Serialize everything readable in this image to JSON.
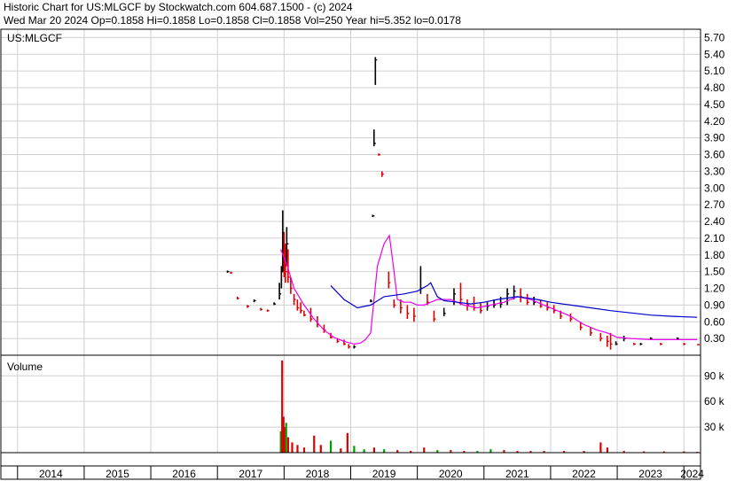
{
  "header": {
    "line1": "Historic Chart for US:MLGCF by Stockwatch.com 604.687.1500 - (c) 2024",
    "line2": "Wed Mar 20 2024   Op=0.1858   Hi=0.1858   Lo=0.1858   Cl=0.1858   Vol=250   Year hi=5.352   lo=0.0178"
  },
  "colors": {
    "background": "#ffffff",
    "grid": "#d0d0d0",
    "price_up": "#000000",
    "price_down": "#dd0000",
    "ma_short": "#ee00ee",
    "ma_long": "#0000cc",
    "volume_up": "#00a000",
    "volume_down": "#dd0000"
  },
  "chart_data": [
    {
      "type": "line",
      "label": "US:MLGCF",
      "grid": true,
      "ylim": [
        0,
        5.85
      ],
      "yticks": [
        "5.70",
        "5.40",
        "5.10",
        "4.80",
        "4.50",
        "4.20",
        "3.90",
        "3.60",
        "3.30",
        "3.00",
        "2.70",
        "2.40",
        "2.10",
        "1.80",
        "1.50",
        "1.20",
        "0.90",
        "0.60",
        "0.30"
      ],
      "yticks_values": [
        5.7,
        5.4,
        5.1,
        4.8,
        4.5,
        4.2,
        3.9,
        3.6,
        3.3,
        3.0,
        2.7,
        2.4,
        2.1,
        1.8,
        1.5,
        1.2,
        0.9,
        0.6,
        0.3
      ],
      "xlim": [
        2013.75,
        2024.25
      ],
      "xticks": [
        "2014",
        "2015",
        "2016",
        "2017",
        "2018",
        "2019",
        "2020",
        "2021",
        "2022",
        "2023",
        "2024"
      ],
      "price_bars": [
        {
          "t": 2017.15,
          "hi": 1.52,
          "lo": 1.48,
          "cl": 1.5
        },
        {
          "t": 2017.2,
          "hi": 1.5,
          "lo": 1.46,
          "cl": 1.48
        },
        {
          "t": 2017.3,
          "hi": 1.05,
          "lo": 1.0,
          "cl": 1.02
        },
        {
          "t": 2017.45,
          "hi": 0.9,
          "lo": 0.85,
          "cl": 0.88
        },
        {
          "t": 2017.55,
          "hi": 1.0,
          "lo": 0.95,
          "cl": 0.98
        },
        {
          "t": 2017.65,
          "hi": 0.85,
          "lo": 0.8,
          "cl": 0.82
        },
        {
          "t": 2017.75,
          "hi": 0.82,
          "lo": 0.78,
          "cl": 0.8
        },
        {
          "t": 2017.85,
          "hi": 0.95,
          "lo": 0.9,
          "cl": 0.92
        },
        {
          "t": 2017.93,
          "hi": 1.3,
          "lo": 1.0,
          "cl": 1.1
        },
        {
          "t": 2017.96,
          "hi": 1.6,
          "lo": 1.2,
          "cl": 1.5
        },
        {
          "t": 2017.98,
          "hi": 2.6,
          "lo": 1.5,
          "cl": 2.2
        },
        {
          "t": 2018.0,
          "hi": 2.2,
          "lo": 1.4,
          "cl": 1.6
        },
        {
          "t": 2018.02,
          "hi": 2.0,
          "lo": 1.3,
          "cl": 1.5
        },
        {
          "t": 2018.04,
          "hi": 2.3,
          "lo": 1.6,
          "cl": 2.0
        },
        {
          "t": 2018.06,
          "hi": 1.9,
          "lo": 1.3,
          "cl": 1.4
        },
        {
          "t": 2018.1,
          "hi": 1.4,
          "lo": 1.1,
          "cl": 1.2
        },
        {
          "t": 2018.15,
          "hi": 1.1,
          "lo": 0.9,
          "cl": 1.0
        },
        {
          "t": 2018.2,
          "hi": 1.0,
          "lo": 0.8,
          "cl": 0.85
        },
        {
          "t": 2018.25,
          "hi": 0.95,
          "lo": 0.75,
          "cl": 0.8
        },
        {
          "t": 2018.3,
          "hi": 0.8,
          "lo": 0.7,
          "cl": 0.72
        },
        {
          "t": 2018.4,
          "hi": 0.85,
          "lo": 0.6,
          "cl": 0.65
        },
        {
          "t": 2018.5,
          "hi": 0.7,
          "lo": 0.5,
          "cl": 0.55
        },
        {
          "t": 2018.6,
          "hi": 0.55,
          "lo": 0.4,
          "cl": 0.45
        },
        {
          "t": 2018.7,
          "hi": 0.4,
          "lo": 0.3,
          "cl": 0.32
        },
        {
          "t": 2018.8,
          "hi": 0.3,
          "lo": 0.22,
          "cl": 0.25
        },
        {
          "t": 2018.9,
          "hi": 0.28,
          "lo": 0.18,
          "cl": 0.2
        },
        {
          "t": 2018.97,
          "hi": 0.2,
          "lo": 0.12,
          "cl": 0.15
        },
        {
          "t": 2019.05,
          "hi": 0.18,
          "lo": 0.12,
          "cl": 0.15
        },
        {
          "t": 2019.3,
          "hi": 1.0,
          "lo": 0.95,
          "cl": 0.97
        },
        {
          "t": 2019.33,
          "hi": 2.52,
          "lo": 2.48,
          "cl": 2.5
        },
        {
          "t": 2019.35,
          "hi": 4.05,
          "lo": 3.75,
          "cl": 3.8
        },
        {
          "t": 2019.37,
          "hi": 5.35,
          "lo": 4.85,
          "cl": 5.3
        },
        {
          "t": 2019.42,
          "hi": 3.62,
          "lo": 3.58,
          "cl": 3.6
        },
        {
          "t": 2019.47,
          "hi": 3.3,
          "lo": 3.2,
          "cl": 3.25
        },
        {
          "t": 2019.57,
          "hi": 1.5,
          "lo": 1.2,
          "cl": 1.3
        },
        {
          "t": 2019.65,
          "hi": 1.0,
          "lo": 0.85,
          "cl": 0.9
        },
        {
          "t": 2019.75,
          "hi": 1.0,
          "lo": 0.75,
          "cl": 0.85
        },
        {
          "t": 2019.85,
          "hi": 0.9,
          "lo": 0.65,
          "cl": 0.75
        },
        {
          "t": 2019.95,
          "hi": 0.85,
          "lo": 0.6,
          "cl": 0.7
        },
        {
          "t": 2020.05,
          "hi": 1.6,
          "lo": 1.1,
          "cl": 1.2
        },
        {
          "t": 2020.15,
          "hi": 1.1,
          "lo": 0.9,
          "cl": 0.95
        },
        {
          "t": 2020.25,
          "hi": 0.8,
          "lo": 0.6,
          "cl": 0.65
        },
        {
          "t": 2020.4,
          "hi": 0.85,
          "lo": 0.7,
          "cl": 0.75
        },
        {
          "t": 2020.55,
          "hi": 1.2,
          "lo": 0.9,
          "cl": 1.1
        },
        {
          "t": 2020.65,
          "hi": 1.3,
          "lo": 0.9,
          "cl": 1.0
        },
        {
          "t": 2020.75,
          "hi": 1.0,
          "lo": 0.8,
          "cl": 0.9
        },
        {
          "t": 2020.85,
          "hi": 1.05,
          "lo": 0.8,
          "cl": 0.85
        },
        {
          "t": 2020.95,
          "hi": 0.95,
          "lo": 0.75,
          "cl": 0.8
        },
        {
          "t": 2021.05,
          "hi": 0.95,
          "lo": 0.8,
          "cl": 0.88
        },
        {
          "t": 2021.15,
          "hi": 1.0,
          "lo": 0.85,
          "cl": 0.9
        },
        {
          "t": 2021.25,
          "hi": 1.05,
          "lo": 0.85,
          "cl": 0.92
        },
        {
          "t": 2021.35,
          "hi": 1.2,
          "lo": 0.9,
          "cl": 1.1
        },
        {
          "t": 2021.45,
          "hi": 1.25,
          "lo": 1.0,
          "cl": 1.15
        },
        {
          "t": 2021.55,
          "hi": 1.2,
          "lo": 0.95,
          "cl": 1.05
        },
        {
          "t": 2021.65,
          "hi": 1.1,
          "lo": 0.9,
          "cl": 0.95
        },
        {
          "t": 2021.75,
          "hi": 1.05,
          "lo": 0.9,
          "cl": 0.95
        },
        {
          "t": 2021.85,
          "hi": 1.0,
          "lo": 0.85,
          "cl": 0.88
        },
        {
          "t": 2021.95,
          "hi": 0.95,
          "lo": 0.8,
          "cl": 0.85
        },
        {
          "t": 2022.05,
          "hi": 0.9,
          "lo": 0.75,
          "cl": 0.8
        },
        {
          "t": 2022.15,
          "hi": 0.8,
          "lo": 0.65,
          "cl": 0.7
        },
        {
          "t": 2022.3,
          "hi": 0.75,
          "lo": 0.6,
          "cl": 0.65
        },
        {
          "t": 2022.45,
          "hi": 0.6,
          "lo": 0.45,
          "cl": 0.5
        },
        {
          "t": 2022.6,
          "hi": 0.5,
          "lo": 0.35,
          "cl": 0.4
        },
        {
          "t": 2022.75,
          "hi": 0.4,
          "lo": 0.25,
          "cl": 0.3
        },
        {
          "t": 2022.85,
          "hi": 0.35,
          "lo": 0.15,
          "cl": 0.25
        },
        {
          "t": 2022.9,
          "hi": 0.4,
          "lo": 0.1,
          "cl": 0.2
        },
        {
          "t": 2022.98,
          "hi": 0.25,
          "lo": 0.18,
          "cl": 0.2
        },
        {
          "t": 2023.1,
          "hi": 0.35,
          "lo": 0.25,
          "cl": 0.3
        },
        {
          "t": 2023.25,
          "hi": 0.22,
          "lo": 0.18,
          "cl": 0.2
        },
        {
          "t": 2023.35,
          "hi": 0.22,
          "lo": 0.18,
          "cl": 0.2
        },
        {
          "t": 2023.5,
          "hi": 0.32,
          "lo": 0.28,
          "cl": 0.3
        },
        {
          "t": 2023.65,
          "hi": 0.22,
          "lo": 0.18,
          "cl": 0.2
        },
        {
          "t": 2023.9,
          "hi": 0.32,
          "lo": 0.28,
          "cl": 0.3
        },
        {
          "t": 2024.0,
          "hi": 0.22,
          "lo": 0.18,
          "cl": 0.2
        },
        {
          "t": 2024.21,
          "hi": 0.2,
          "lo": 0.18,
          "cl": 0.19
        }
      ],
      "series": [
        {
          "color": "#ee00ee",
          "x": [
            2017.95,
            2018.05,
            2018.15,
            2018.3,
            2018.45,
            2018.6,
            2018.75,
            2018.9,
            2019.05,
            2019.15,
            2019.22,
            2019.3,
            2019.4,
            2019.5,
            2019.58,
            2019.64,
            2019.7,
            2019.8,
            2019.9,
            2020.0,
            2020.1,
            2020.2,
            2020.3,
            2020.5,
            2020.7,
            2020.9,
            2021.1,
            2021.3,
            2021.5,
            2021.7,
            2021.9,
            2022.1,
            2022.3,
            2022.5,
            2022.7,
            2022.85,
            2023.0,
            2023.2,
            2023.5,
            2023.8,
            2024.2
          ],
          "y": [
            1.9,
            1.6,
            1.2,
            0.9,
            0.65,
            0.45,
            0.32,
            0.25,
            0.2,
            0.22,
            0.28,
            0.4,
            1.6,
            2.0,
            2.15,
            1.6,
            1.0,
            0.95,
            0.95,
            0.9,
            0.9,
            0.95,
            1.0,
            1.0,
            0.9,
            0.85,
            0.9,
            0.95,
            1.05,
            1.0,
            0.9,
            0.8,
            0.7,
            0.55,
            0.45,
            0.4,
            0.32,
            0.3,
            0.28,
            0.28,
            0.28
          ]
        },
        {
          "color": "#0000cc",
          "x": [
            2018.7,
            2018.9,
            2019.1,
            2019.3,
            2019.5,
            2019.8,
            2020.0,
            2020.15,
            2020.2,
            2020.3,
            2020.4,
            2020.6,
            2020.8,
            2021.0,
            2021.2,
            2021.5,
            2021.8,
            2022.0,
            2022.3,
            2022.6,
            2022.9,
            2023.2,
            2023.5,
            2023.8,
            2024.2
          ],
          "y": [
            1.25,
            1.0,
            0.85,
            0.9,
            1.05,
            1.1,
            1.15,
            1.25,
            1.3,
            1.05,
            0.98,
            0.95,
            0.92,
            0.95,
            1.0,
            1.05,
            1.0,
            0.95,
            0.9,
            0.85,
            0.8,
            0.76,
            0.72,
            0.7,
            0.68
          ]
        }
      ]
    },
    {
      "type": "bar",
      "label": "Volume",
      "ylim": [
        0,
        110000
      ],
      "yticks": [
        "90 k",
        "60 k",
        "30 k"
      ],
      "yticks_values": [
        90000,
        60000,
        30000
      ],
      "bars": [
        {
          "t": 2017.95,
          "v": 25000,
          "up": true
        },
        {
          "t": 2017.97,
          "v": 108000,
          "up": false
        },
        {
          "t": 2017.99,
          "v": 42000,
          "up": false
        },
        {
          "t": 2018.01,
          "v": 30000,
          "up": false
        },
        {
          "t": 2018.03,
          "v": 35000,
          "up": true
        },
        {
          "t": 2018.06,
          "v": 18000,
          "up": false
        },
        {
          "t": 2018.12,
          "v": 12000,
          "up": false
        },
        {
          "t": 2018.2,
          "v": 9000,
          "up": false
        },
        {
          "t": 2018.3,
          "v": 6000,
          "up": false
        },
        {
          "t": 2018.45,
          "v": 20000,
          "up": false
        },
        {
          "t": 2018.55,
          "v": 9000,
          "up": false
        },
        {
          "t": 2018.7,
          "v": 14000,
          "up": true
        },
        {
          "t": 2018.85,
          "v": 5000,
          "up": false
        },
        {
          "t": 2018.95,
          "v": 23000,
          "up": false
        },
        {
          "t": 2019.05,
          "v": 8000,
          "up": true
        },
        {
          "t": 2019.2,
          "v": 4000,
          "up": true
        },
        {
          "t": 2019.35,
          "v": 6000,
          "up": false
        },
        {
          "t": 2019.5,
          "v": 4000,
          "up": true
        },
        {
          "t": 2019.7,
          "v": 3000,
          "up": false
        },
        {
          "t": 2019.9,
          "v": 2000,
          "up": false
        },
        {
          "t": 2020.1,
          "v": 6000,
          "up": false
        },
        {
          "t": 2020.3,
          "v": 3000,
          "up": true
        },
        {
          "t": 2020.5,
          "v": 3000,
          "up": false
        },
        {
          "t": 2020.7,
          "v": 2000,
          "up": false
        },
        {
          "t": 2020.9,
          "v": 2000,
          "up": true
        },
        {
          "t": 2021.1,
          "v": 4000,
          "up": true
        },
        {
          "t": 2021.3,
          "v": 3000,
          "up": false
        },
        {
          "t": 2021.5,
          "v": 2000,
          "up": false
        },
        {
          "t": 2021.7,
          "v": 2000,
          "up": false
        },
        {
          "t": 2021.9,
          "v": 2000,
          "up": false
        },
        {
          "t": 2022.2,
          "v": 2000,
          "up": false
        },
        {
          "t": 2022.5,
          "v": 2000,
          "up": false
        },
        {
          "t": 2022.75,
          "v": 12000,
          "up": false
        },
        {
          "t": 2022.85,
          "v": 6000,
          "up": false
        },
        {
          "t": 2023.1,
          "v": 2000,
          "up": false
        },
        {
          "t": 2023.4,
          "v": 1500,
          "up": false
        },
        {
          "t": 2023.7,
          "v": 1500,
          "up": false
        },
        {
          "t": 2024.0,
          "v": 1500,
          "up": false
        },
        {
          "t": 2024.2,
          "v": 1000,
          "up": false
        }
      ]
    }
  ]
}
